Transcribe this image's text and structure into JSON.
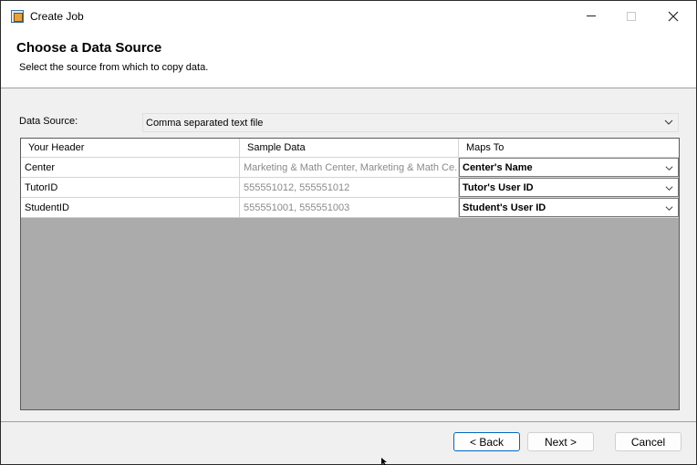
{
  "window": {
    "title": "Create Job"
  },
  "header": {
    "title": "Choose a Data Source",
    "subtitle": "Select the source from which to copy data."
  },
  "data_source": {
    "label": "Data Source:",
    "value": "Comma separated text file"
  },
  "grid": {
    "columns": [
      "Your Header",
      "Sample Data",
      "Maps To"
    ],
    "rows": [
      {
        "header": "Center",
        "sample": "Marketing & Math Center, Marketing & Math Ce...",
        "maps_to": "Center's Name"
      },
      {
        "header": "TutorID",
        "sample": "555551012, 555551012",
        "maps_to": "Tutor's User ID"
      },
      {
        "header": "StudentID",
        "sample": "555551001, 555551003",
        "maps_to": "Student's User ID"
      }
    ]
  },
  "footer": {
    "back_label": "< Back",
    "next_label": "Next >",
    "cancel_label": "Cancel"
  },
  "icons": {
    "app": "app-icon",
    "minimize": "minimize-icon",
    "maximize": "maximize-icon",
    "close": "close-icon",
    "dropdown": "chevron-down-icon"
  }
}
